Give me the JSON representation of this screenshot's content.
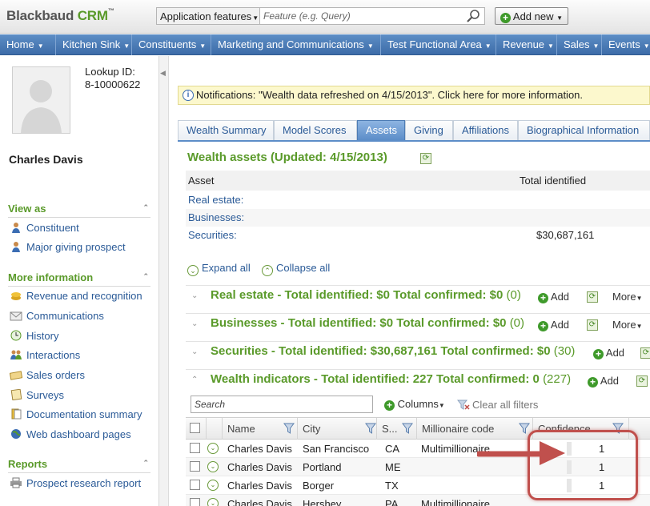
{
  "header": {
    "logo_main": "Blackbaud ",
    "logo_accent": "CRM",
    "logo_tm": "™",
    "search_scope": "Application features",
    "search_placeholder": "Feature (e.g. Query)",
    "add_new_label": "Add new"
  },
  "nav": {
    "items": [
      "Home",
      "Kitchen Sink",
      "Constituents",
      "Marketing and Communications",
      "Test Functional Area",
      "Revenue",
      "Sales",
      "Events"
    ]
  },
  "sidebar": {
    "lookup_label": "Lookup ID:",
    "lookup_value": "8-10000622",
    "name": "Charles Davis",
    "view_as_title": "View as",
    "view_as_items": [
      "Constituent",
      "Major giving prospect"
    ],
    "more_info_title": "More information",
    "more_info_items": [
      "Revenue and recognition",
      "Communications",
      "History",
      "Interactions",
      "Sales orders",
      "Surveys",
      "Documentation summary",
      "Web dashboard pages"
    ],
    "reports_title": "Reports",
    "reports_items": [
      "Prospect research report"
    ]
  },
  "notification": "Notifications: \"Wealth data refreshed on 4/15/2013\". Click here for more information.",
  "tabs": [
    "Wealth Summary",
    "Model Scores",
    "Assets",
    "Giving",
    "Affiliations",
    "Biographical Information"
  ],
  "active_tab": "Assets",
  "wealth_assets": {
    "title": "Wealth assets (Updated: 4/15/2013)",
    "col_asset": "Asset",
    "col_total": "Total identified",
    "rows": [
      {
        "label": "Real estate:",
        "value": ""
      },
      {
        "label": "Businesses:",
        "value": ""
      },
      {
        "label": "Securities:",
        "value": "$30,687,161"
      }
    ]
  },
  "expand_all": "Expand all",
  "collapse_all": "Collapse all",
  "groups": [
    {
      "title": "Real estate - Total identified: $0 Total confirmed: $0",
      "count": "(0)",
      "add": "Add",
      "more": "More"
    },
    {
      "title": "Businesses - Total identified: $0 Total confirmed: $0",
      "count": "(0)",
      "add": "Add",
      "more": "More"
    },
    {
      "title": "Securities - Total identified: $30,687,161 Total confirmed: $0",
      "count": "(30)",
      "add": "Add"
    },
    {
      "title": "Wealth indicators - Total identified: 227 Total confirmed: 0",
      "count": "(227)",
      "add": "Add"
    }
  ],
  "grid": {
    "search_placeholder": "Search",
    "columns_label": "Columns",
    "clear_filters": "Clear all filters",
    "headers": [
      "Name",
      "City",
      "S...",
      "Millionaire code",
      "Confidence"
    ],
    "rows": [
      {
        "name": "Charles Davis",
        "city": "San Francisco",
        "state": "CA",
        "millionaire": "Multimillionaire",
        "confidence": "1"
      },
      {
        "name": "Charles Davis",
        "city": "Portland",
        "state": "ME",
        "millionaire": "",
        "confidence": "1"
      },
      {
        "name": "Charles Davis",
        "city": "Borger",
        "state": "TX",
        "millionaire": "",
        "confidence": "1"
      },
      {
        "name": "Charles Davis",
        "city": "Hershey",
        "state": "PA",
        "millionaire": "Multimillionaire",
        "confidence": ""
      }
    ]
  },
  "colors": {
    "nav_blue": "#3d6ca8",
    "accent_green": "#5a9a2a",
    "link_blue": "#2a5a97",
    "highlight_red": "#c0504d"
  }
}
